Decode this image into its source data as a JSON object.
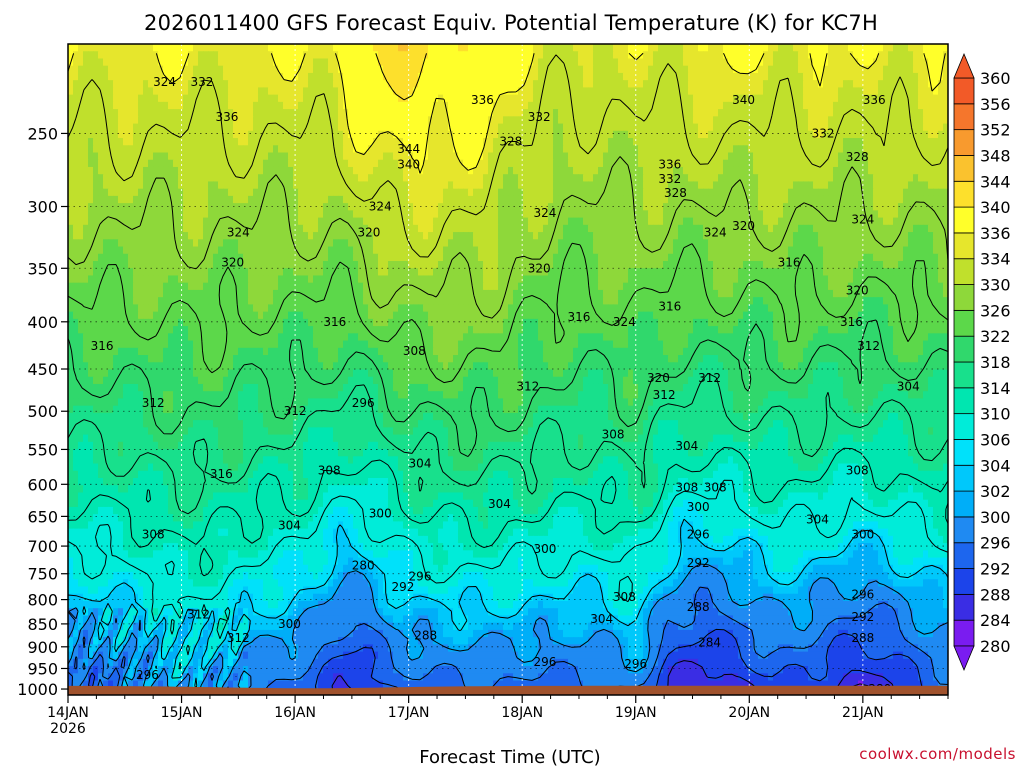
{
  "chart_data": {
    "type": "heatmap",
    "title": "2026011400 GFS Forecast Equiv. Potential Temperature (K) for KC7H",
    "xlabel": "Forecast Time (UTC)",
    "ylabel": "",
    "credit": "coolwx.com/models",
    "x_ticks": [
      "14JAN",
      "15JAN",
      "16JAN",
      "17JAN",
      "18JAN",
      "19JAN",
      "20JAN",
      "21JAN"
    ],
    "x_year": "2026",
    "xlim_days": [
      0,
      7.75
    ],
    "y_ticks": [
      250,
      300,
      350,
      400,
      450,
      500,
      550,
      600,
      650,
      700,
      750,
      800,
      850,
      900,
      950,
      1000
    ],
    "ylim_hpa": [
      200,
      1015
    ],
    "colorbar_levels": [
      280,
      284,
      288,
      292,
      296,
      300,
      302,
      304,
      306,
      310,
      314,
      318,
      322,
      326,
      330,
      334,
      336,
      340,
      344,
      348,
      352,
      356,
      360
    ],
    "colorbar_colors": [
      "#7a1cf0",
      "#3a2de4",
      "#1c44ea",
      "#1d66ee",
      "#1f8af2",
      "#00aef8",
      "#00c8fb",
      "#00e1fa",
      "#00ecd9",
      "#00e6b0",
      "#18e08c",
      "#30d86c",
      "#5cd84a",
      "#8ed83a",
      "#c0e02c",
      "#e6e62c",
      "#ffff2a",
      "#fde02c",
      "#fac22e",
      "#f89a2e",
      "#f5762c",
      "#f25a28"
    ],
    "contour_interval": 4,
    "contour_labels": [
      {
        "time": 0.85,
        "p": 220,
        "v": "324"
      },
      {
        "time": 1.18,
        "p": 220,
        "v": "332"
      },
      {
        "time": 1.4,
        "p": 240,
        "v": "336"
      },
      {
        "time": 3.0,
        "p": 260,
        "v": "344"
      },
      {
        "time": 3.0,
        "p": 270,
        "v": "340"
      },
      {
        "time": 3.65,
        "p": 230,
        "v": "336"
      },
      {
        "time": 4.15,
        "p": 240,
        "v": "332"
      },
      {
        "time": 3.9,
        "p": 255,
        "v": "328"
      },
      {
        "time": 5.95,
        "p": 230,
        "v": "340"
      },
      {
        "time": 7.1,
        "p": 230,
        "v": "336"
      },
      {
        "time": 6.65,
        "p": 250,
        "v": "332"
      },
      {
        "time": 6.95,
        "p": 265,
        "v": "328"
      },
      {
        "time": 5.3,
        "p": 270,
        "v": "336"
      },
      {
        "time": 5.3,
        "p": 280,
        "v": "332"
      },
      {
        "time": 5.35,
        "p": 290,
        "v": "328"
      },
      {
        "time": 2.75,
        "p": 300,
        "v": "324"
      },
      {
        "time": 4.2,
        "p": 305,
        "v": "324"
      },
      {
        "time": 7.0,
        "p": 310,
        "v": "324"
      },
      {
        "time": 1.5,
        "p": 320,
        "v": "324"
      },
      {
        "time": 2.65,
        "p": 320,
        "v": "320"
      },
      {
        "time": 5.7,
        "p": 320,
        "v": "324"
      },
      {
        "time": 5.95,
        "p": 315,
        "v": "320"
      },
      {
        "time": 1.45,
        "p": 345,
        "v": "320"
      },
      {
        "time": 4.15,
        "p": 350,
        "v": "320"
      },
      {
        "time": 6.35,
        "p": 345,
        "v": "316"
      },
      {
        "time": 6.95,
        "p": 370,
        "v": "320"
      },
      {
        "time": 5.3,
        "p": 385,
        "v": "316"
      },
      {
        "time": 4.5,
        "p": 395,
        "v": "316"
      },
      {
        "time": 4.9,
        "p": 400,
        "v": "324"
      },
      {
        "time": 2.35,
        "p": 400,
        "v": "316"
      },
      {
        "time": 6.9,
        "p": 400,
        "v": "316"
      },
      {
        "time": 0.3,
        "p": 425,
        "v": "316"
      },
      {
        "time": 3.05,
        "p": 430,
        "v": "308"
      },
      {
        "time": 7.05,
        "p": 425,
        "v": "312"
      },
      {
        "time": 5.2,
        "p": 460,
        "v": "320"
      },
      {
        "time": 5.25,
        "p": 480,
        "v": "312"
      },
      {
        "time": 5.65,
        "p": 460,
        "v": "312"
      },
      {
        "time": 4.05,
        "p": 470,
        "v": "312"
      },
      {
        "time": 7.4,
        "p": 470,
        "v": "304"
      },
      {
        "time": 0.75,
        "p": 490,
        "v": "312"
      },
      {
        "time": 2.0,
        "p": 500,
        "v": "312"
      },
      {
        "time": 2.6,
        "p": 490,
        "v": "296"
      },
      {
        "time": 4.8,
        "p": 530,
        "v": "308"
      },
      {
        "time": 5.45,
        "p": 545,
        "v": "304"
      },
      {
        "time": 3.1,
        "p": 570,
        "v": "304"
      },
      {
        "time": 1.35,
        "p": 585,
        "v": "316"
      },
      {
        "time": 2.3,
        "p": 580,
        "v": "308"
      },
      {
        "time": 6.95,
        "p": 580,
        "v": "308"
      },
      {
        "time": 5.45,
        "p": 605,
        "v": "308"
      },
      {
        "time": 5.7,
        "p": 605,
        "v": "308"
      },
      {
        "time": 3.8,
        "p": 630,
        "v": "304"
      },
      {
        "time": 5.55,
        "p": 635,
        "v": "300"
      },
      {
        "time": 2.75,
        "p": 645,
        "v": "300"
      },
      {
        "time": 6.6,
        "p": 655,
        "v": "304"
      },
      {
        "time": 1.95,
        "p": 665,
        "v": "304"
      },
      {
        "time": 0.75,
        "p": 680,
        "v": "308"
      },
      {
        "time": 7.0,
        "p": 680,
        "v": "300"
      },
      {
        "time": 5.55,
        "p": 680,
        "v": "296"
      },
      {
        "time": 4.2,
        "p": 705,
        "v": "300"
      },
      {
        "time": 5.55,
        "p": 730,
        "v": "292"
      },
      {
        "time": 2.6,
        "p": 735,
        "v": "280"
      },
      {
        "time": 3.1,
        "p": 755,
        "v": "296"
      },
      {
        "time": 2.95,
        "p": 775,
        "v": "292"
      },
      {
        "time": 7.0,
        "p": 790,
        "v": "296"
      },
      {
        "time": 4.9,
        "p": 795,
        "v": "308"
      },
      {
        "time": 5.55,
        "p": 815,
        "v": "288"
      },
      {
        "time": 1.15,
        "p": 830,
        "v": "312"
      },
      {
        "time": 7.0,
        "p": 835,
        "v": "292"
      },
      {
        "time": 4.7,
        "p": 840,
        "v": "304"
      },
      {
        "time": 1.95,
        "p": 850,
        "v": "300"
      },
      {
        "time": 3.15,
        "p": 875,
        "v": "288"
      },
      {
        "time": 1.5,
        "p": 880,
        "v": "312"
      },
      {
        "time": 7.0,
        "p": 880,
        "v": "288"
      },
      {
        "time": 5.65,
        "p": 890,
        "v": "284"
      },
      {
        "time": 4.2,
        "p": 935,
        "v": "296"
      },
      {
        "time": 5.0,
        "p": 940,
        "v": "296"
      },
      {
        "time": 0.7,
        "p": 965,
        "v": "296"
      },
      {
        "time": 7.15,
        "p": 1000,
        "v": "280"
      }
    ]
  }
}
